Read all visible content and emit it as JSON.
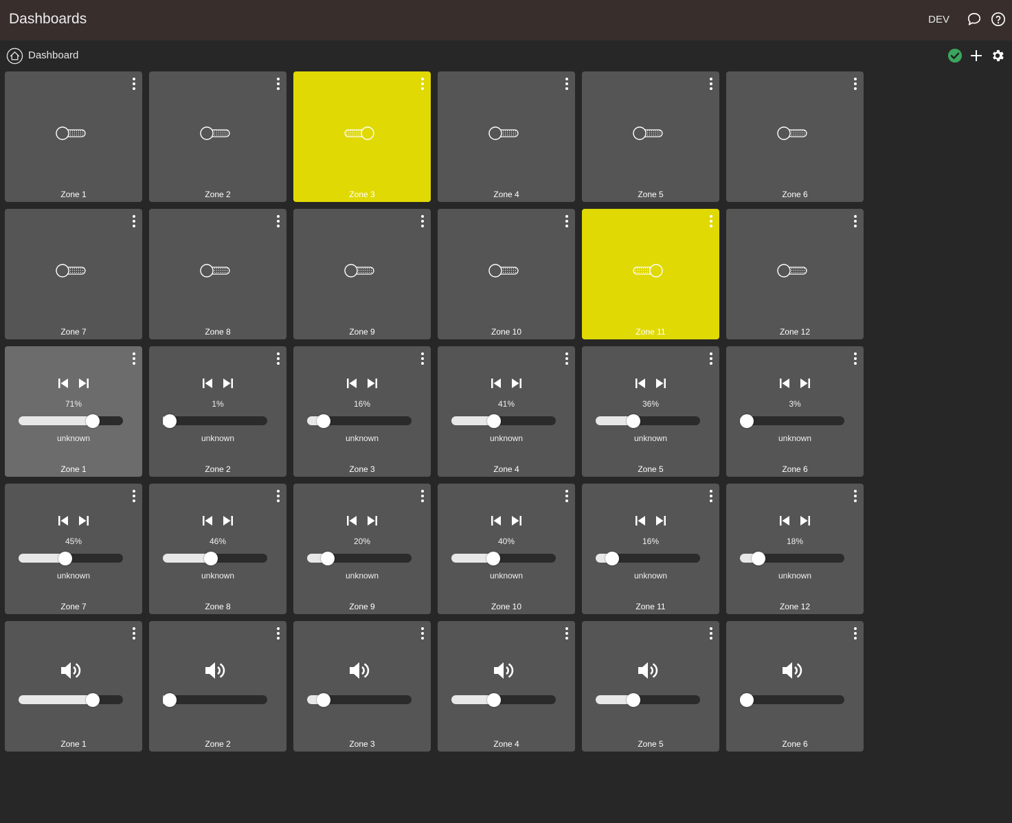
{
  "header": {
    "title": "Dashboards",
    "env_label": "DEV",
    "icons": [
      "chat-bubble-icon",
      "help-circle-icon"
    ]
  },
  "subheader": {
    "dashboard_label": "Dashboard",
    "icons": [
      "home-assistant-icon",
      "check-circle-icon",
      "plus-icon",
      "gear-icon"
    ],
    "status_color": "#3aa55c"
  },
  "colors": {
    "tile": "#555555",
    "tile_active": "#e0d904",
    "background": "#272727",
    "header": "#382e2c"
  },
  "switch_tiles": [
    {
      "label": "Zone 1",
      "on": false
    },
    {
      "label": "Zone 2",
      "on": false
    },
    {
      "label": "Zone 3",
      "on": true
    },
    {
      "label": "Zone 4",
      "on": false
    },
    {
      "label": "Zone 5",
      "on": false
    },
    {
      "label": "Zone 6",
      "on": false
    },
    {
      "label": "Zone 7",
      "on": false
    },
    {
      "label": "Zone 8",
      "on": false
    },
    {
      "label": "Zone 9",
      "on": false
    },
    {
      "label": "Zone 10",
      "on": false
    },
    {
      "label": "Zone 11",
      "on": true
    },
    {
      "label": "Zone 12",
      "on": false
    }
  ],
  "media_tiles": [
    {
      "label": "Zone 1",
      "volume_text": "71%",
      "volume": 71,
      "status": "unknown",
      "highlighted": true
    },
    {
      "label": "Zone 2",
      "volume_text": "1%",
      "volume": 1,
      "status": "unknown"
    },
    {
      "label": "Zone 3",
      "volume_text": "16%",
      "volume": 16,
      "status": "unknown"
    },
    {
      "label": "Zone 4",
      "volume_text": "41%",
      "volume": 41,
      "status": "unknown"
    },
    {
      "label": "Zone 5",
      "volume_text": "36%",
      "volume": 36,
      "status": "unknown"
    },
    {
      "label": "Zone 6",
      "volume_text": "3%",
      "volume": 3,
      "status": "unknown"
    },
    {
      "label": "Zone 7",
      "volume_text": "45%",
      "volume": 45,
      "status": "unknown"
    },
    {
      "label": "Zone 8",
      "volume_text": "46%",
      "volume": 46,
      "status": "unknown"
    },
    {
      "label": "Zone 9",
      "volume_text": "20%",
      "volume": 20,
      "status": "unknown"
    },
    {
      "label": "Zone 10",
      "volume_text": "40%",
      "volume": 40,
      "status": "unknown"
    },
    {
      "label": "Zone 11",
      "volume_text": "16%",
      "volume": 16,
      "status": "unknown"
    },
    {
      "label": "Zone 12",
      "volume_text": "18%",
      "volume": 18,
      "status": "unknown"
    }
  ],
  "volume_tiles": [
    {
      "label": "Zone 1",
      "volume": 71
    },
    {
      "label": "Zone 2",
      "volume": 1
    },
    {
      "label": "Zone 3",
      "volume": 16
    },
    {
      "label": "Zone 4",
      "volume": 41
    },
    {
      "label": "Zone 5",
      "volume": 36
    },
    {
      "label": "Zone 6",
      "volume": 3
    }
  ]
}
